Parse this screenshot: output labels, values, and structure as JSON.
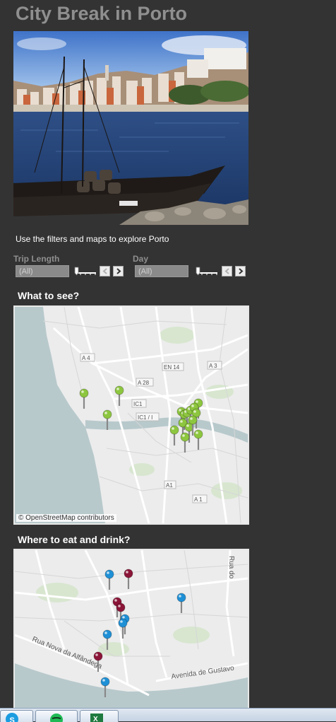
{
  "page": {
    "title": "City Break in Porto",
    "subtitle": "Use the filters and maps to explore Porto"
  },
  "filters": [
    {
      "label": "Trip Length",
      "value": "(All)"
    },
    {
      "label": "Day",
      "value": "(All)"
    }
  ],
  "sections": {
    "see_title": "What to see?",
    "eat_title": "Where to eat and drink?"
  },
  "map_see": {
    "attribution": "© OpenStreetMap contributors",
    "road_labels": [
      "A 4",
      "EN 14",
      "A 3",
      "A 28",
      "IC1",
      "IC1 / I",
      "A1",
      "A 1"
    ],
    "pin_color": "#8dc63f",
    "pin_count": 16
  },
  "map_eat": {
    "road_labels": [
      "Rua Nova da Alfândega",
      "Avenida de Gustavo",
      "Rua do"
    ],
    "pin_colors": {
      "eat": "#8b1538",
      "drink": "#1e90d6"
    },
    "pin_count": 11
  },
  "icons": {
    "prev": "chevron-left-icon",
    "next": "chevron-right-icon",
    "taskbar": [
      "skype-icon",
      "spotify-icon",
      "excel-icon"
    ]
  },
  "colors": {
    "background": "#333333",
    "title": "#8f8f8f",
    "water": "#b8c9cc"
  }
}
